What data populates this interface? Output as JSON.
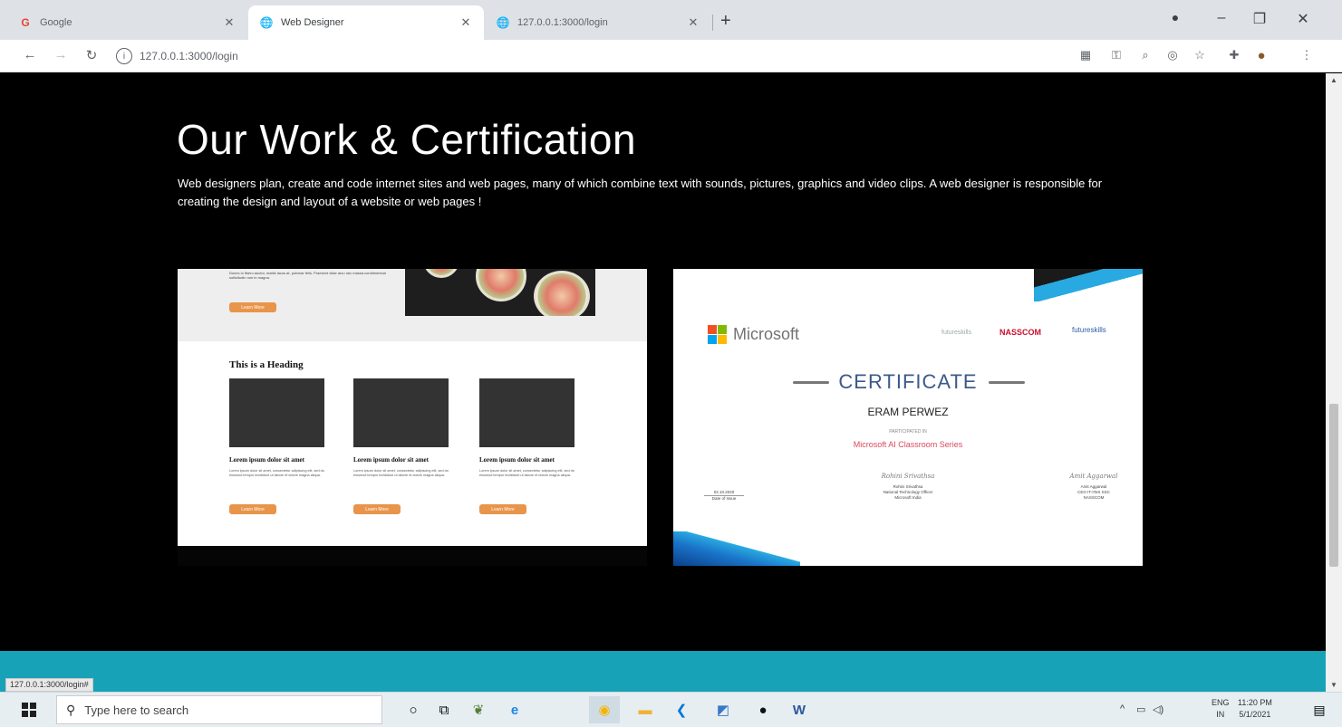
{
  "browser": {
    "tabs": [
      {
        "title": "Google",
        "icon": "google-icon"
      },
      {
        "title": "Web Designer",
        "icon": "globe-icon"
      },
      {
        "title": "127.0.0.1:3000/login",
        "icon": "globe-icon"
      }
    ],
    "url": "127.0.0.1:3000/login",
    "status_link": "127.0.0.1:3000/login#"
  },
  "page": {
    "heading": "Our Work & Certification",
    "description": "Web designers plan, create and code internet sites and web pages, many of which combine text with sounds, pictures, graphics and video clips. A web designer is responsible for creating the design and layout of a website or web pages !",
    "work_card": {
      "top_text": "Donec in libero auctor, mattis lacus at, pulvinar felis. Praesent vitae arcu nec massa condimentum sollicitudin non in magna.",
      "top_button": "Learn More",
      "heading": "This is a Heading",
      "items": [
        {
          "title": "Lorem ipsum dolor sit amet",
          "text": "Lorem ipsum dolor sit amet, consectetur adipiscing elit, sed do eiusmod tempor incididunt ut labore et dolore magna aliqua.",
          "button": "Learn More"
        },
        {
          "title": "Lorem ipsum dolor sit amet",
          "text": "Lorem ipsum dolor sit amet, consectetur adipiscing elit, sed do eiusmod tempor incididunt ut labore et dolore magna aliqua.",
          "button": "Learn More"
        },
        {
          "title": "Lorem ipsum dolor sit amet",
          "text": "Lorem ipsum dolor sit amet, consectetur adipiscing elit, sed do eiusmod tempor incididunt ut labore et dolore magna aliqua.",
          "button": "Learn More"
        }
      ]
    },
    "certificate": {
      "issuer": "Microsoft",
      "partner_1": "futureskills",
      "partner_2": "NASSCOM",
      "partner_3": "futureskills",
      "title": "CERTIFICATE",
      "recipient": "ERAM PERWEZ",
      "participated": "PARTICIPATED IN",
      "program": "Microsoft AI Classroom Series",
      "date": "02.10.2020",
      "date_label": "Date of Issue",
      "signer_1_sig": "Rohini Srivathsa",
      "signer_1_name": "Rohini Srivathsa",
      "signer_1_role": "National Technology Officer",
      "signer_1_org": "Microsoft India",
      "signer_2_sig": "Amit Aggarwal",
      "signer_2_name": "Amit Aggarwal",
      "signer_2_role": "CEO IT-ITeS SSC",
      "signer_2_org": "NASSCOM"
    }
  },
  "taskbar": {
    "search_placeholder": "Type here to search",
    "lang_top": "ENG",
    "lang_bottom": "IN",
    "time": "11:20 PM",
    "date": "5/1/2021"
  },
  "colors": {
    "teal_band": "#17a2b8",
    "accent_orange": "#e8944a",
    "cert_blue": "#3c5a8a",
    "cert_red": "#d8495b"
  }
}
